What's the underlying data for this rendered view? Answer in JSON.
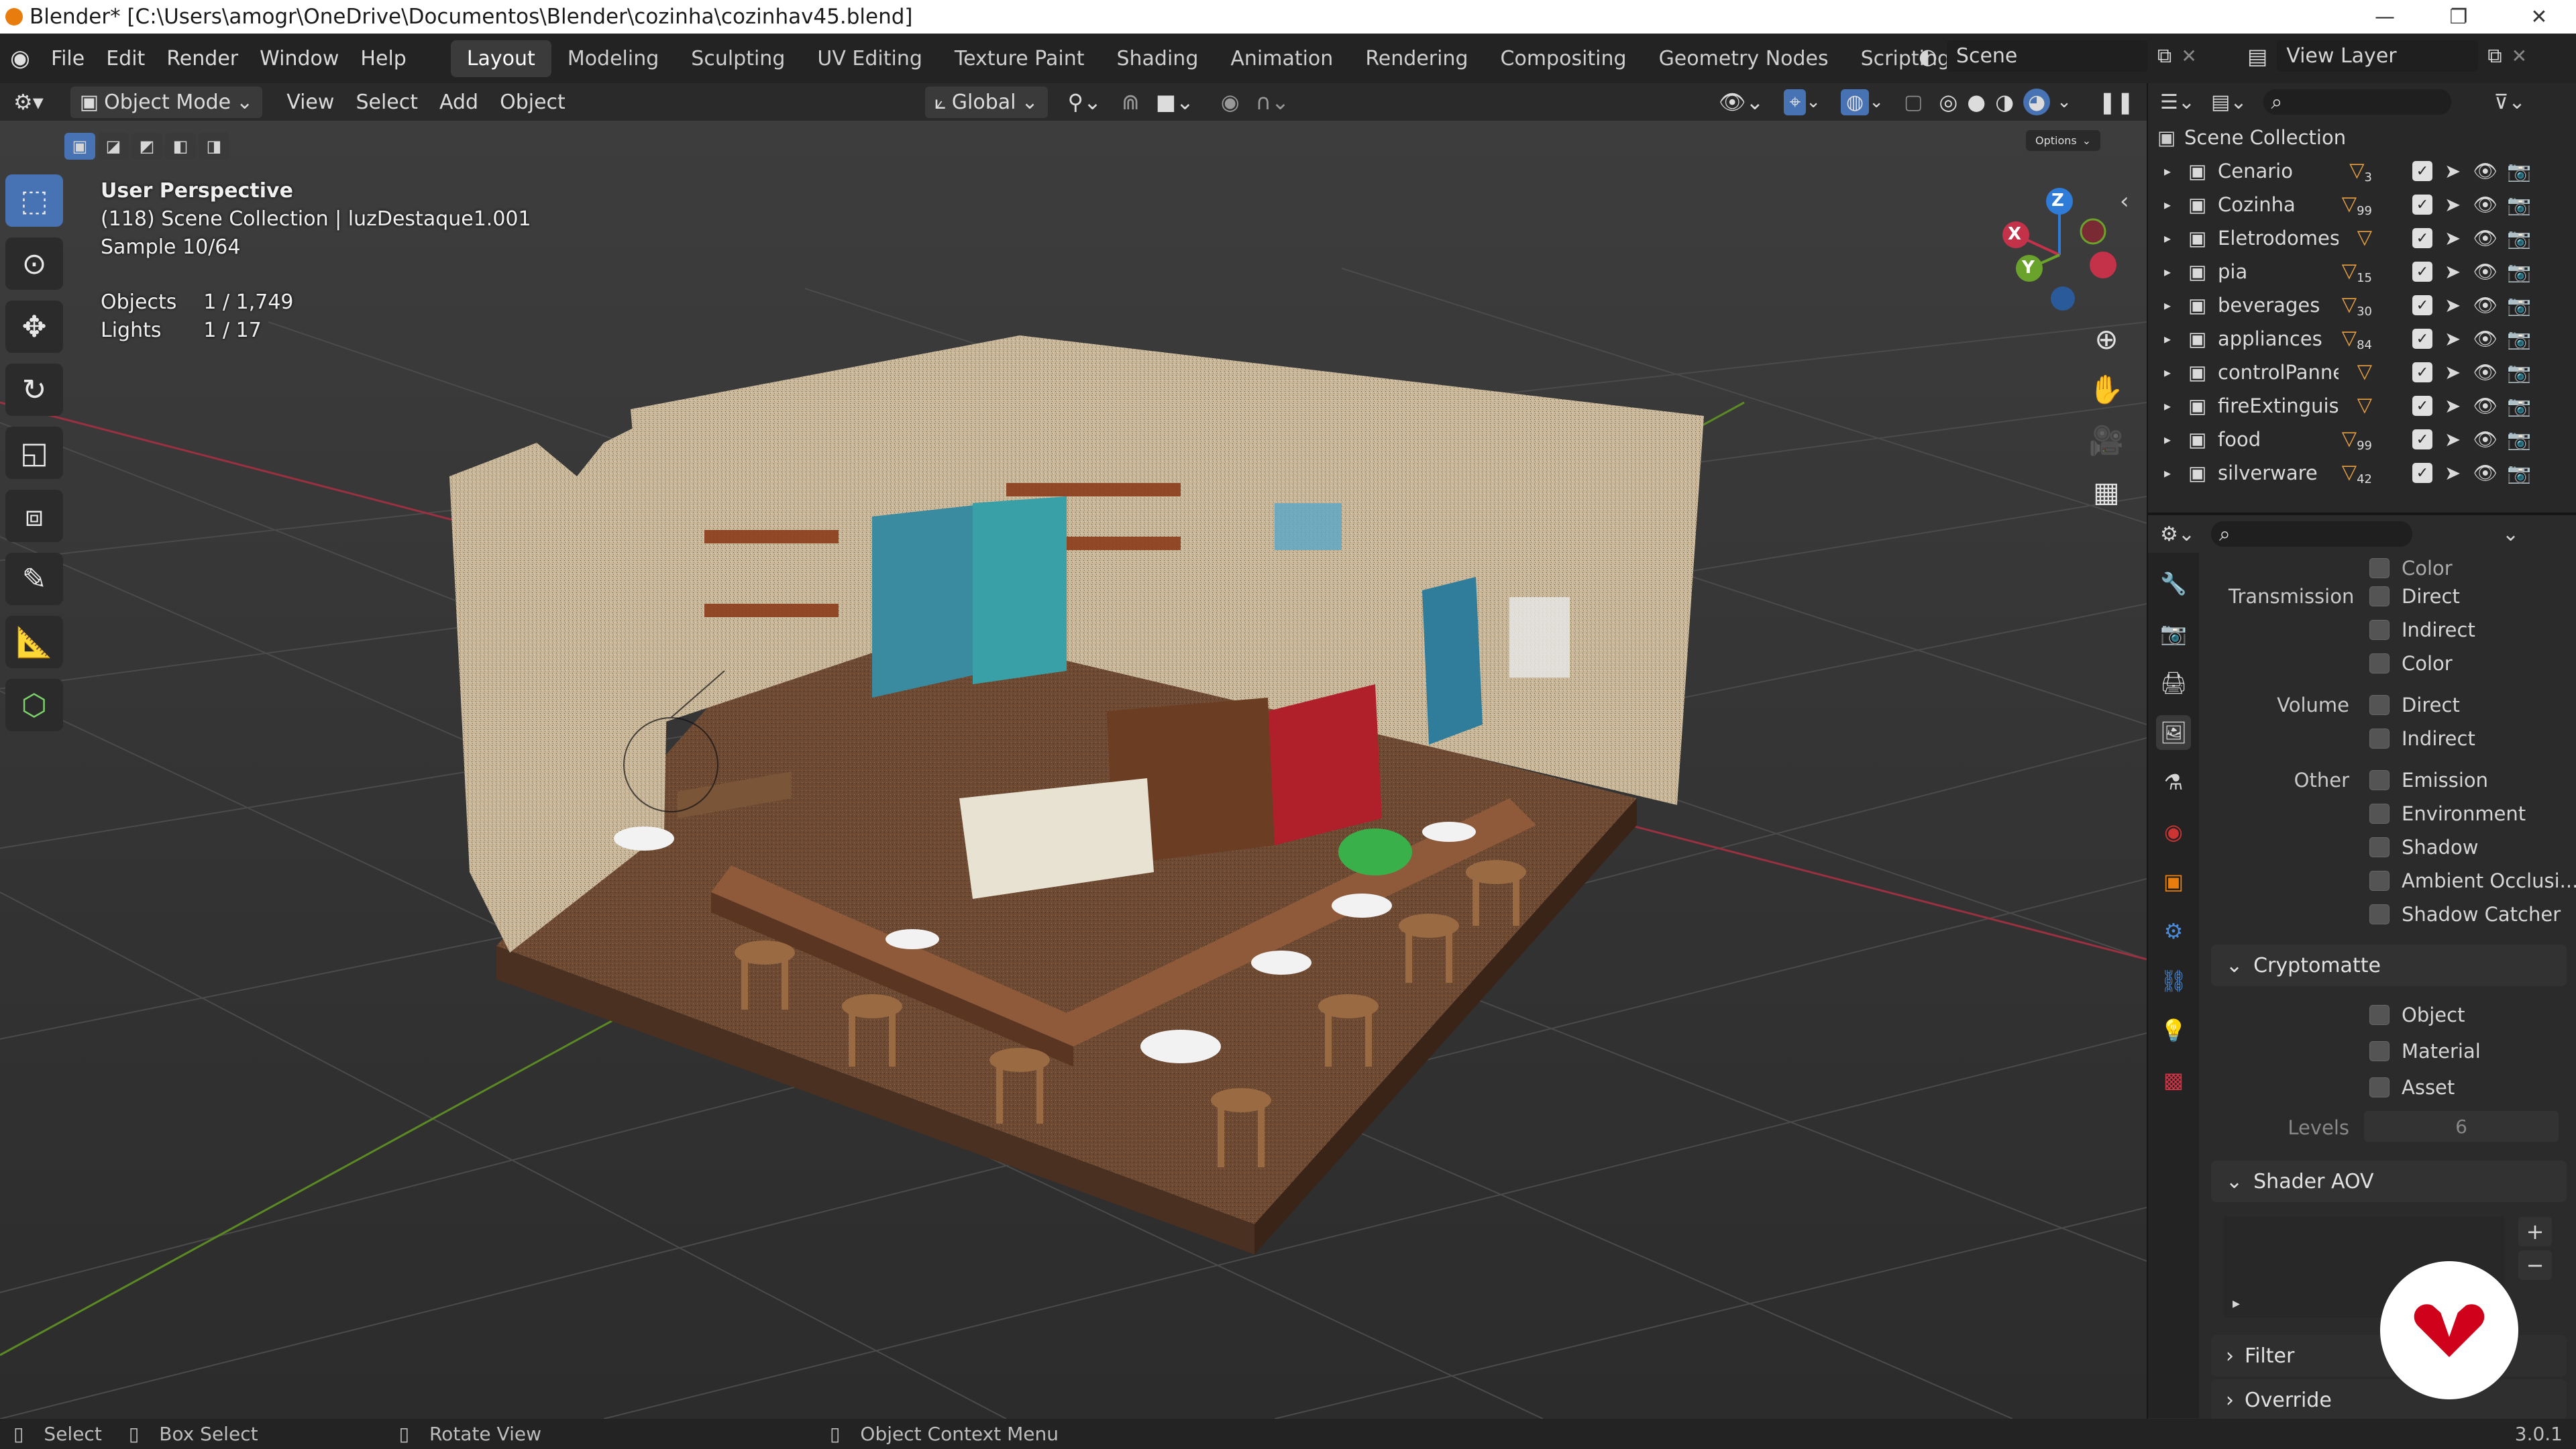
{
  "title": "Blender* [C:\\Users\\amogr\\OneDrive\\Documentos\\Blender\\cozinha\\cozinhav45.blend]",
  "menu": [
    "File",
    "Edit",
    "Render",
    "Window",
    "Help"
  ],
  "workspaces": [
    "Layout",
    "Modeling",
    "Sculpting",
    "UV Editing",
    "Texture Paint",
    "Shading",
    "Animation",
    "Rendering",
    "Compositing",
    "Geometry Nodes",
    "Scripting"
  ],
  "active_workspace": "Layout",
  "add_tab": "+",
  "scene_label": "Scene",
  "viewlayer_label": "View Layer",
  "header": {
    "mode": "Object Mode",
    "items": [
      "View",
      "Select",
      "Add",
      "Object"
    ],
    "orientation": "Global",
    "options": "Options"
  },
  "viewport": {
    "perspective": "User Perspective",
    "collection_info": "(118) Scene Collection | luzDestaque1.001",
    "sample": "Sample 10/64",
    "objects_label": "Objects",
    "objects_value": "1 / 1,749",
    "lights_label": "Lights",
    "lights_value": "1 / 17",
    "gizmo": {
      "z": "Z",
      "y": "Y",
      "x": "X"
    },
    "collapse_arrow": "‹"
  },
  "outliner": {
    "root": "Scene Collection",
    "items": [
      {
        "name": "Cenario",
        "badge": "3"
      },
      {
        "name": "Cozinha",
        "badge": "99"
      },
      {
        "name": "Eletrodomesticos",
        "badge": ""
      },
      {
        "name": "pia",
        "badge": "15"
      },
      {
        "name": "beverages",
        "badge": "30"
      },
      {
        "name": "appliances",
        "badge": "84"
      },
      {
        "name": "controlPannel",
        "badge": ""
      },
      {
        "name": "fireExtinguisher",
        "badge": ""
      },
      {
        "name": "food",
        "badge": "99"
      },
      {
        "name": "silverware",
        "badge": "42"
      }
    ]
  },
  "properties": {
    "cut_off_label": "Color",
    "transmission": {
      "label": "Transmission",
      "items": [
        "Direct",
        "Indirect",
        "Color"
      ]
    },
    "volume": {
      "label": "Volume",
      "items": [
        "Direct",
        "Indirect"
      ]
    },
    "other": {
      "label": "Other",
      "items": [
        "Emission",
        "Environment",
        "Shadow",
        "Ambient Occlusi...",
        "Shadow Catcher"
      ]
    },
    "cryptomatte": {
      "label": "Cryptomatte",
      "items": [
        "Object",
        "Material",
        "Asset"
      ],
      "levels_label": "Levels",
      "levels_value": "6"
    },
    "shader_aov": "Shader AOV",
    "filter": "Filter",
    "override": "Override"
  },
  "status": {
    "select": "Select",
    "box_select": "Box Select",
    "rotate": "Rotate View",
    "context": "Object Context Menu",
    "version": "3.0.1"
  },
  "colors": {
    "accent": "#4772b3",
    "x_axis": "#c4324a",
    "y_axis": "#6aa32b",
    "z_axis": "#2f7bd8",
    "logo_red": "#d0021b"
  }
}
